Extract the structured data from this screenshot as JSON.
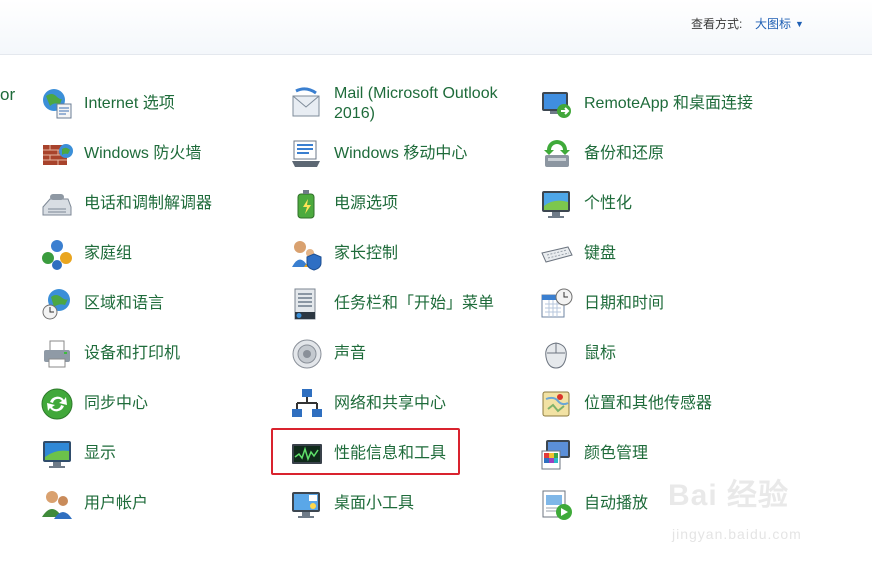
{
  "header": {
    "view_by_label": "查看方式:",
    "view_by_value": "大图标"
  },
  "edge_text": "or",
  "items": {
    "internet": "Internet 选项",
    "mail": "Mail (Microsoft Outlook 2016)",
    "remoteapp": "RemoteApp 和桌面连接",
    "firewall": "Windows 防火墙",
    "mobility": "Windows 移动中心",
    "backup": "备份和还原",
    "phone": "电话和调制解调器",
    "power": "电源选项",
    "personalize": "个性化",
    "homegroup": "家庭组",
    "parental": "家长控制",
    "keyboard": "键盘",
    "region": "区域和语言",
    "taskbar": "任务栏和「开始」菜单",
    "datetime": "日期和时间",
    "devices": "设备和打印机",
    "sound": "声音",
    "mouse": "鼠标",
    "sync": "同步中心",
    "network": "网络和共享中心",
    "location": "位置和其他传感器",
    "display": "显示",
    "performance": "性能信息和工具",
    "color": "颜色管理",
    "accounts": "用户帐户",
    "gadgets": "桌面小工具",
    "autoplay": "自动播放"
  },
  "watermark": {
    "logo": "Bai 经验",
    "url": "jingyan.baidu.com"
  }
}
